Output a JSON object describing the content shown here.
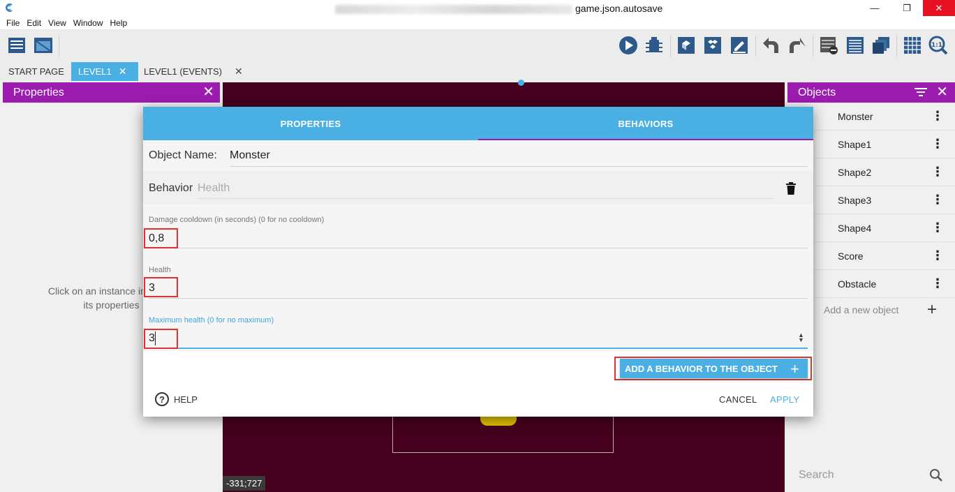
{
  "window": {
    "title_suffix": "game.json.autosave",
    "min_icon": "minimize-icon",
    "restore_icon": "restore-icon",
    "close_icon": "close-icon"
  },
  "menu": [
    "File",
    "Edit",
    "View",
    "Window",
    "Help"
  ],
  "tabs": [
    {
      "label": "START PAGE",
      "active": false
    },
    {
      "label": "LEVEL1",
      "active": true
    },
    {
      "label": "LEVEL1 (EVENTS)",
      "active": false
    }
  ],
  "properties_panel": {
    "title": "Properties",
    "hint_line1": "Click on an instance in the sc",
    "hint_line2": "its properties"
  },
  "scene": {
    "coords": "-331;727"
  },
  "objects_panel": {
    "title": "Objects",
    "items": [
      {
        "label": "Monster",
        "color": "#e0c000"
      },
      {
        "label": "Shape1",
        "color": "#e0c000"
      },
      {
        "label": "Shape2",
        "color": "#c8a060"
      },
      {
        "label": "Shape3",
        "color": "#4ab0e4"
      },
      {
        "label": "Shape4",
        "color": "#e06070"
      },
      {
        "label": "Score",
        "color": "#3a70b0"
      },
      {
        "label": "Obstacle",
        "color": "#401010"
      }
    ],
    "add_label": "Add a new object",
    "search_placeholder": "Search"
  },
  "dialog": {
    "tab_properties": "PROPERTIES",
    "tab_behaviors": "BEHAVIORS",
    "object_name_label": "Object Name:",
    "object_name_value": "Monster",
    "behavior_label": "Behavior",
    "behavior_value": "Health",
    "fields": [
      {
        "label": "Damage cooldown (in seconds) (0 for no cooldown)",
        "value": "0,8"
      },
      {
        "label": "Health",
        "value": "3"
      },
      {
        "label": "Maximum health (0 for no maximum)",
        "value": "3"
      }
    ],
    "add_behavior_label": "ADD A BEHAVIOR TO THE OBJECT",
    "help_label": "HELP",
    "cancel_label": "CANCEL",
    "apply_label": "APPLY"
  },
  "colors": {
    "accent_blue": "#4ab0e4",
    "panel_purple": "#9c1cb0",
    "scene_bg": "#45001d",
    "highlight_red": "#e03030"
  }
}
